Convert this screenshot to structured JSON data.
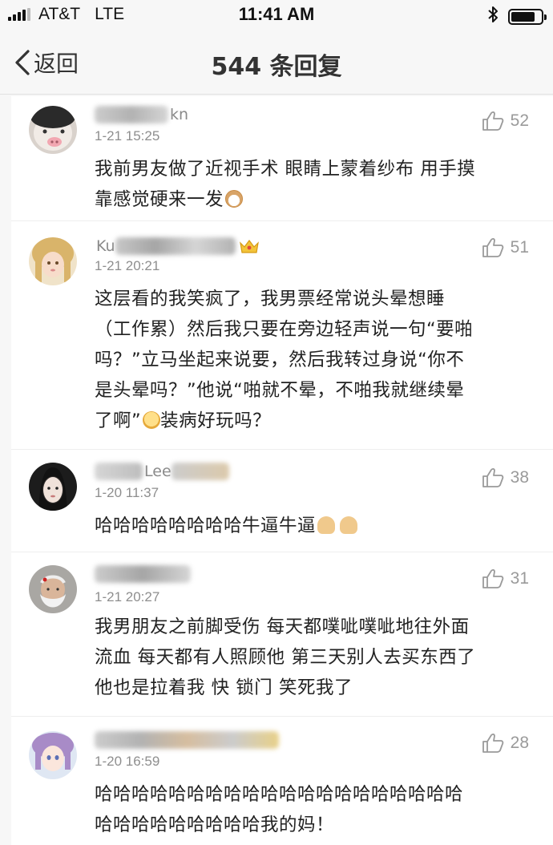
{
  "status_bar": {
    "carrier": "AT&T",
    "network": "LTE",
    "time": "11:41 AM",
    "bluetooth_icon": "bluetooth-icon",
    "battery_level": 0.8
  },
  "nav": {
    "back_label": "返回",
    "title": "544 条回复"
  },
  "comments": [
    {
      "name_visible": "kn",
      "time": "1-21 15:25",
      "likes": "52",
      "line1": "我前男友做了近视手术 眼睛上蒙着纱布 用手摸",
      "line2": "靠感觉硬来一发"
    },
    {
      "name_visible": "Ku",
      "time": "1-21 20:21",
      "likes": "51",
      "line1": "这层看的我笑疯了，我男票经常说头晕想睡",
      "line2": "（工作累）然后我只要在旁边轻声说一句“要啪",
      "line3": "吗？”立马坐起来说要，然后我转过身说“你不",
      "line4": "是头晕吗？”他说“啪就不晕，不啪我就继续晕",
      "line5": "了啊”",
      "line5b": "装病好玩吗？"
    },
    {
      "name_visible": "Lee",
      "time": "1-20 11:37",
      "likes": "38",
      "line1": "哈哈哈哈哈哈哈哈牛逼牛逼"
    },
    {
      "name_visible": "",
      "time": "1-21 20:27",
      "likes": "31",
      "line1": "我男朋友之前脚受伤 每天都噗呲噗呲地往外面",
      "line2": "流血 每天都有人照顾他 第三天别人去买东西了",
      "line3": "他也是拉着我 快 锁门 笑死我了"
    },
    {
      "name_visible": "",
      "time": "1-20 16:59",
      "likes": "28",
      "line1": "哈哈哈哈哈哈哈哈哈哈哈哈哈哈哈哈哈哈哈哈",
      "line2": "哈哈哈哈哈哈哈哈哈我的妈！"
    }
  ]
}
